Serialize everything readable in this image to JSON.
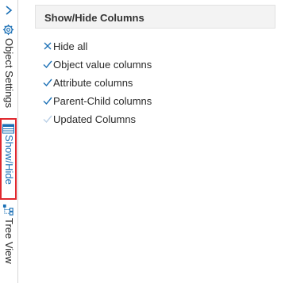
{
  "sidebar": {
    "tabs": [
      {
        "label": "Object Settings",
        "icon": "gear-icon"
      },
      {
        "label": "Show/Hide",
        "icon": "columns-icon"
      },
      {
        "label": "Tree View",
        "icon": "tree-icon"
      }
    ],
    "active_tab": "Show/Hide",
    "collapse_icon": "chevron-right-icon"
  },
  "panel": {
    "title": "Show/Hide Columns",
    "options": [
      {
        "label": "Hide all",
        "mark": "x"
      },
      {
        "label": "Object value columns",
        "mark": "check"
      },
      {
        "label": "Attribute columns",
        "mark": "check"
      },
      {
        "label": "Parent-Child columns",
        "mark": "check"
      },
      {
        "label": "Updated Columns",
        "mark": "check-faded"
      }
    ]
  },
  "colors": {
    "accent": "#1a6fb5",
    "highlight_border": "#e0282e",
    "faded_check": "#b9cfe6"
  }
}
